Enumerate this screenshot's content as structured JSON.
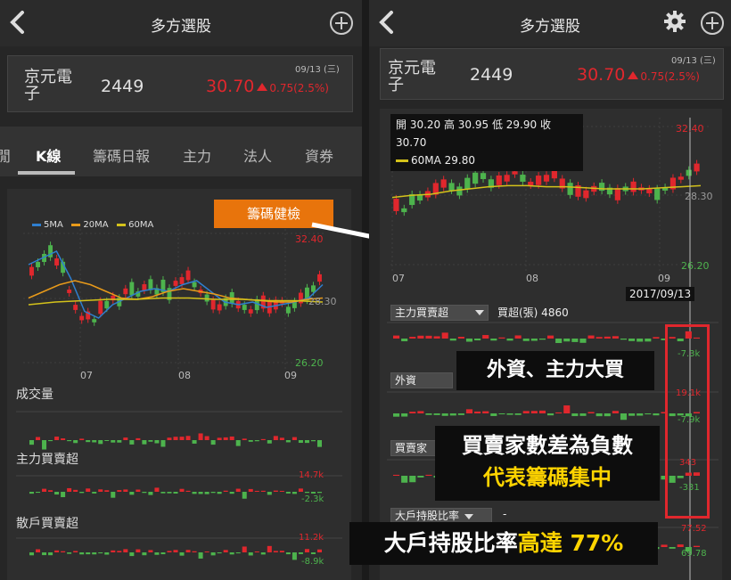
{
  "left": {
    "header_title": "多方選股",
    "quote": {
      "name": "京元電子",
      "code": "2449",
      "date": "09/13 (三)",
      "price": "30.70",
      "change": "0.75(2.5%)"
    },
    "tabs": [
      "K線",
      "籌碼日報",
      "主力",
      "法人",
      "資券"
    ],
    "tab_partial": "",
    "chart": {
      "legend": [
        "5MA",
        "20MA",
        "60MA"
      ],
      "y_high": "32.40",
      "y_mid": "28.30",
      "y_low": "26.20",
      "x_ticks": [
        "07",
        "08",
        "09"
      ],
      "volume_label": "成交量",
      "main_force_label": "主力買賣超",
      "main_force_high": "14.7k",
      "main_force_low": "-2.3k",
      "retail_label": "散戶買賣超",
      "retail_high": "11.2k",
      "retail_low": "-8.9k"
    },
    "callout_button": "籌碼健檢"
  },
  "right": {
    "header_title": "多方選股",
    "quote": {
      "name": "京元電子",
      "code": "2449",
      "date": "09/13 (三)",
      "price": "30.70",
      "change": "0.75(2.5%)"
    },
    "ohlc": "開 30.20 高 30.95 低 29.90 收 30.70",
    "ma_legend": "60MA 29.80",
    "y_high": "32.40",
    "y_mid": "28.30",
    "y_low": "26.20",
    "x_ticks": [
      "07",
      "08",
      "09"
    ],
    "cursor_date": "2017/09/13",
    "main_force_select": "主力買賣超",
    "main_force_value": "買超(張) 4860",
    "main_force_low": "-7.3k",
    "foreign_select": "外資",
    "foreign_high": "19.1k",
    "foreign_low": "-7.9k",
    "diff_select": "買賣家",
    "diff_high": "343",
    "diff_low": "-331",
    "holder_select": "大戶持股比率",
    "holder_value": "-",
    "holder_high": "77.52",
    "holder_low": "69.78"
  },
  "callouts": {
    "c1": "外資、主力大買",
    "c2_line1": "買賣家數差為負數",
    "c2_line2": "代表籌碼集中",
    "c3_part1": "大戶持股比率",
    "c3_part2": "高達 77%"
  },
  "colors": {
    "up": "#e0272d",
    "down": "#4db34d",
    "ma5": "#2f7fd0",
    "ma20": "#e89a1a",
    "ma60": "#d4c21a",
    "highlight": "#ffd400",
    "callout_border": "#e0272d"
  }
}
